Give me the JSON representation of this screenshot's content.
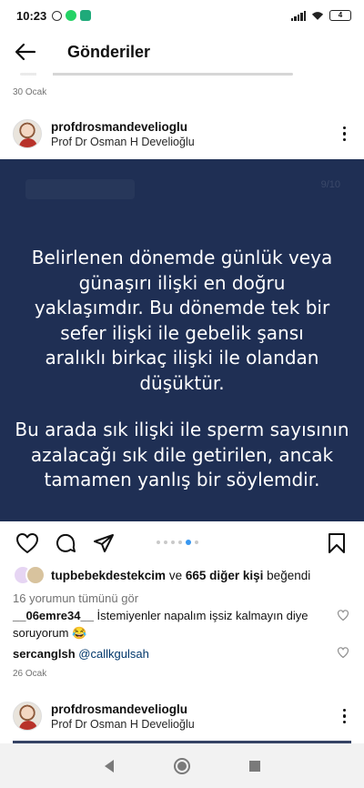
{
  "status_bar": {
    "time": "10:23",
    "battery": "4"
  },
  "header": {
    "title": "Gönderiler"
  },
  "previous_post": {
    "date": "30 Ocak"
  },
  "post": {
    "username": "profdrosmandevelioglu",
    "subtitle": "Prof Dr Osman H Develioğlu",
    "page_indicator": "9/10",
    "paragraph1": "Belirlenen dönemde günlük veya günaşırı ilişki en doğru yaklaşımdır. Bu dönemde tek bir sefer ilişki ile gebelik şansı aralıklı birkaç ilişki ile olandan düşüktür.",
    "paragraph2": "Bu arada sık ilişki ile sperm sayısının azalacağı sık dile getirilen, ancak tamamen yanlış bir söylemdir.",
    "carousel": {
      "count": 6,
      "active_index": 4,
      "accent": "#3897f0"
    },
    "likes": {
      "user": "tupbebekdestekcim",
      "connector": "ve",
      "others": "665 diğer kişi",
      "suffix": "beğendi"
    },
    "view_all_comments": "16 yorumun tümünü gör",
    "comments": [
      {
        "user": "__06emre34__",
        "text": "İstemiyenler napalım işsiz kalmayın diye soruyorum 😂"
      },
      {
        "user": "sercanglsh",
        "mention": "@callkgulsah"
      }
    ],
    "date": "26 Ocak"
  },
  "next_post": {
    "username": "profdrosmandevelioglu",
    "subtitle": "Prof Dr Osman H Develioğlu"
  },
  "colors": {
    "post_bg": "#1f2f54",
    "accent": "#3897f0",
    "muted_text": "#737373"
  },
  "icons": {
    "back": "arrow-left-icon",
    "more": "more-vertical-icon",
    "like": "heart-icon",
    "comment": "comment-icon",
    "share": "paper-plane-icon",
    "save": "bookmark-icon",
    "nav_back": "triangle-back-icon",
    "nav_home": "circle-home-icon",
    "nav_recents": "square-recents-icon"
  }
}
